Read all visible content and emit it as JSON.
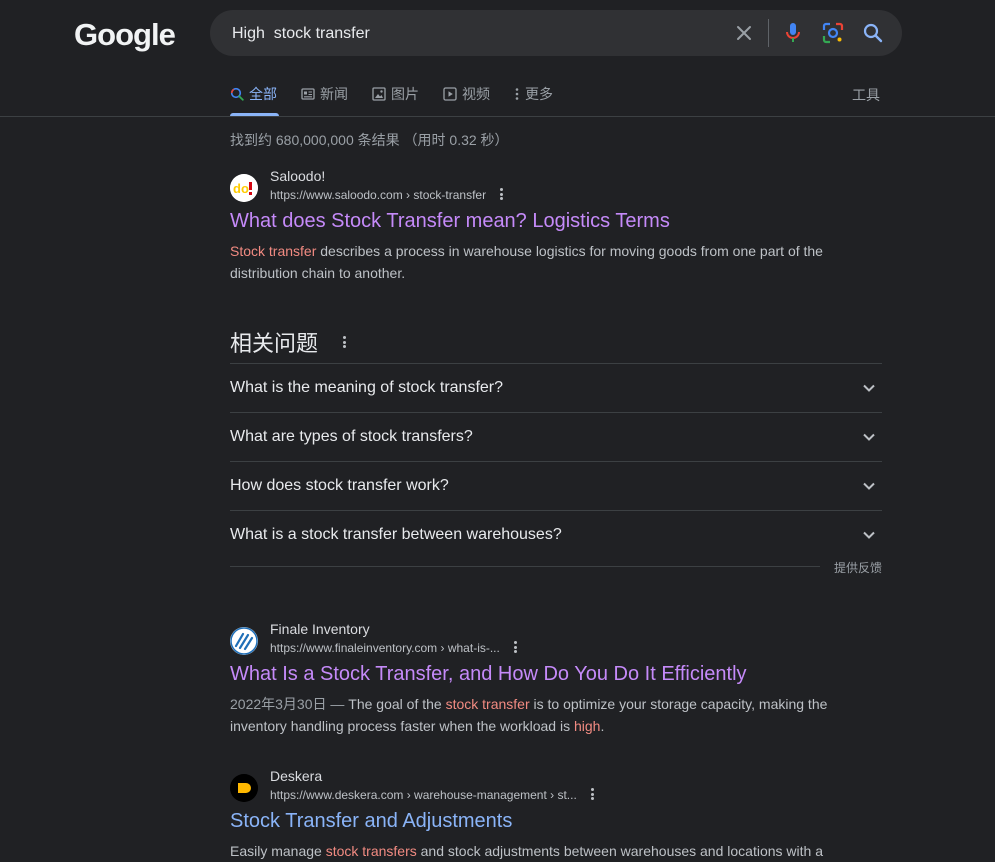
{
  "logo": {
    "text": "Google",
    "letters": [
      "G",
      "o",
      "o",
      "g",
      "l",
      "e"
    ]
  },
  "search": {
    "query": "High  stock transfer"
  },
  "tabs": [
    {
      "label": "全部",
      "icon": "search-icon"
    },
    {
      "label": "新闻",
      "icon": "news-icon"
    },
    {
      "label": "图片",
      "icon": "image-icon"
    },
    {
      "label": "视频",
      "icon": "video-icon"
    },
    {
      "label": "更多",
      "icon": "more-vert-icon"
    }
  ],
  "tools_label": "工具",
  "stats": "找到约 680,000,000 条结果 （用时 0.32 秒）",
  "results": [
    {
      "site": "Saloodo!",
      "url": "https://www.saloodo.com › stock-transfer",
      "title": "What does Stock Transfer mean? Logistics Terms",
      "snippet_hl1": "Stock transfer",
      "snippet_rest1": " describes a process in warehouse logistics for moving goods from one part of the distribution chain to another."
    },
    {
      "site": "Finale Inventory",
      "url": "https://www.finaleinventory.com › what-is-...",
      "title": "What Is a Stock Transfer, and How Do You Do It Efficiently",
      "date": "2022年3月30日 — ",
      "snippet_a": "The goal of the ",
      "snippet_hl1": "stock transfer",
      "snippet_b": " is to optimize your storage capacity, making the inventory handling process faster when the workload is ",
      "snippet_hl2": "high",
      "snippet_c": "."
    },
    {
      "site": "Deskera",
      "url": "https://www.deskera.com › warehouse-management › st...",
      "title": "Stock Transfer and Adjustments",
      "snippet_a": "Easily manage ",
      "snippet_hl1": "stock transfers",
      "snippet_b": " and stock adjustments between warehouses and locations with a"
    }
  ],
  "paa": {
    "heading": "相关问题",
    "questions": [
      "What is the meaning of stock transfer?",
      "What are types of stock transfers?",
      "How does stock transfer work?",
      "What is a stock transfer between warehouses?"
    ],
    "feedback": "提供反馈"
  },
  "colors": {
    "background": "#202124",
    "link_visited": "#c58af9",
    "link": "#8ab4f8",
    "highlight": "#f28b82"
  }
}
